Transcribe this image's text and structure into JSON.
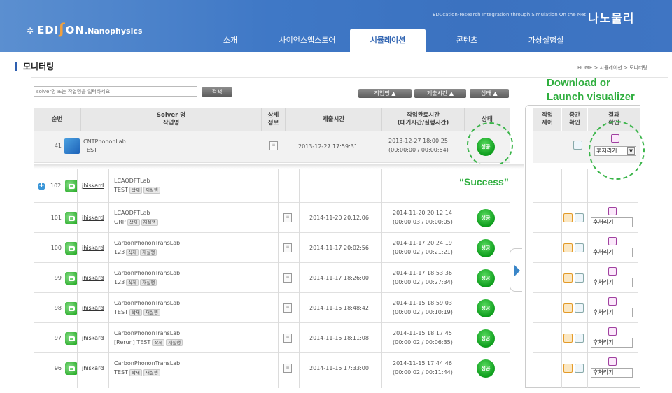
{
  "header": {
    "logo_text": "EDI",
    "logo_text2": "ON",
    "logo_suffix": ".Nanophysics",
    "tagline": "EDucation-research Integration through Simulation On the Net",
    "brand": "나노물리"
  },
  "nav": [
    "소개",
    "사이언스앱스토어",
    "시뮬레이션",
    "콘텐츠",
    "가상실험실"
  ],
  "page": {
    "title": "모니터링",
    "breadcrumb": "HOME > 시뮬레이션 > 모니터링"
  },
  "search": {
    "placeholder": "solver명 또는 작업명을 입력하세요",
    "button": "검색"
  },
  "sort_buttons": [
    "작업명 ▲",
    "제출시간 ▲",
    "상태 ▲"
  ],
  "annotations": {
    "download": "Download or",
    "launch": "Launch visualizer",
    "success": "“Success”"
  },
  "columns": {
    "seq": "순번",
    "solver1": "Solver 명",
    "solver2": "작업명",
    "detail1": "상세",
    "detail2": "정보",
    "submit": "제출시간",
    "done1": "작업완료시간",
    "done2": "(대기시간/실행시간)",
    "status": "상태",
    "control1": "작업",
    "control2": "제어",
    "mid1": "중간",
    "mid2": "확인",
    "result1": "결과",
    "result2": "확인"
  },
  "top_row": {
    "seq": "41",
    "solver": "CNTPhononLab",
    "job": "TEST",
    "submit": "2013-12-27 17:59:31",
    "done": "2013-12-27 18:00:25",
    "wait": "(00:00:00 / 00:00:54)",
    "status": "성공",
    "select": "후처리기"
  },
  "rows": [
    {
      "seq": "102",
      "user": "jhiskard",
      "solver": "LCAODFTLab",
      "job": "TEST",
      "tags": [
        "삭제",
        "재실행"
      ],
      "submit": "",
      "done": "",
      "wait": "",
      "status": "",
      "select": ""
    },
    {
      "seq": "101",
      "user": "jhiskard",
      "solver": "LCAODFTLab",
      "job": "GRP",
      "tags": [
        "삭제",
        "재실행"
      ],
      "submit": "2014-11-20 20:12:06",
      "done": "2014-11-20 20:12:14",
      "wait": "(00:00:03 / 00:00:05)",
      "status": "성공",
      "select": "후처리기"
    },
    {
      "seq": "100",
      "user": "jhiskard",
      "solver": "CarbonPhononTransLab",
      "job": "123",
      "tags": [
        "삭제",
        "재실행"
      ],
      "submit": "2014-11-17 20:02:56",
      "done": "2014-11-17 20:24:19",
      "wait": "(00:00:02 / 00:21:21)",
      "status": "성공",
      "select": "후처리기"
    },
    {
      "seq": "99",
      "user": "jhiskard",
      "solver": "CarbonPhononTransLab",
      "job": "123",
      "tags": [
        "삭제",
        "재실행"
      ],
      "submit": "2014-11-17 18:26:00",
      "done": "2014-11-17 18:53:36",
      "wait": "(00:00:02 / 00:27:34)",
      "status": "성공",
      "select": "후처리기"
    },
    {
      "seq": "98",
      "user": "jhiskard",
      "solver": "CarbonPhononTransLab",
      "job": "TEST",
      "tags": [
        "삭제",
        "재실행"
      ],
      "submit": "2014-11-15 18:48:42",
      "done": "2014-11-15 18:59:03",
      "wait": "(00:00:02 / 00:10:19)",
      "status": "성공",
      "select": "후처리기"
    },
    {
      "seq": "97",
      "user": "jhiskard",
      "solver": "CarbonPhononTransLab",
      "job": "[Rerun] TEST",
      "tags": [
        "삭제",
        "재실행"
      ],
      "submit": "2014-11-15 18:11:08",
      "done": "2014-11-15 18:17:45",
      "wait": "(00:00:02 / 00:06:35)",
      "status": "성공",
      "select": "후처리기"
    },
    {
      "seq": "96",
      "user": "jhiskard",
      "solver": "CarbonPhononTransLab",
      "job": "TEST",
      "tags": [
        "삭제",
        "재실행"
      ],
      "submit": "2014-11-15 17:33:00",
      "done": "2014-11-15 17:44:46",
      "wait": "(00:00:02 / 00:11:44)",
      "status": "성공",
      "select": "후처리기"
    }
  ],
  "colors": {
    "header_blue": "#3f78c6",
    "success_green": "#13a21f",
    "annotation_green": "#2fae3e"
  }
}
